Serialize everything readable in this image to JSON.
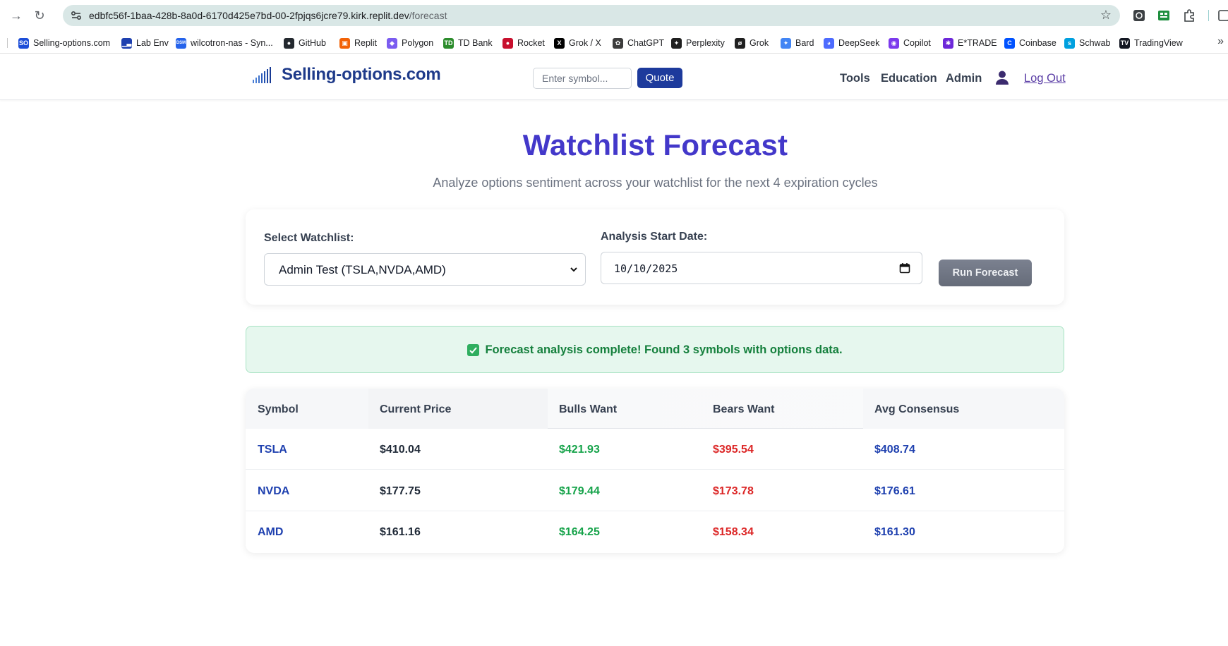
{
  "browser": {
    "url_host": "edbfc56f-1baa-428b-8a0d-6170d425e7bd-00-2fpjqs6jcre79.kirk.replit.dev",
    "url_path": "/forecast",
    "bookmarks": [
      {
        "label": "Selling-options.com",
        "icon": "so-favicon",
        "color": "#1d4ed8",
        "glyph": "SO"
      },
      {
        "label": "Lab Env",
        "icon": "lab-chart-favicon",
        "color": "#1e40af",
        "glyph": "▁▃"
      },
      {
        "label": "wilcotron-nas - Syn...",
        "icon": "dsm-favicon",
        "color": "#2563eb",
        "glyph": "DSM"
      },
      {
        "label": "GitHub",
        "icon": "github-icon",
        "color": "#24292f",
        "glyph": "●"
      },
      {
        "label": "Replit",
        "icon": "replit-icon",
        "color": "#f26207",
        "glyph": "▣"
      },
      {
        "label": "Polygon",
        "icon": "polygon-icon",
        "color": "#7b5cf0",
        "glyph": "◆"
      },
      {
        "label": "TD Bank",
        "icon": "td-bank-icon",
        "color": "#2c8c2c",
        "glyph": "TD"
      },
      {
        "label": "Rocket",
        "icon": "rocket-icon",
        "color": "#c8102e",
        "glyph": "●"
      },
      {
        "label": "Grok / X",
        "icon": "x-icon",
        "color": "#000000",
        "glyph": "X"
      },
      {
        "label": "ChatGPT",
        "icon": "chatgpt-icon",
        "color": "#3c3c3c",
        "glyph": "✿"
      },
      {
        "label": "Perplexity",
        "icon": "perplexity-icon",
        "color": "#1f1f1f",
        "glyph": "✦"
      },
      {
        "label": "Grok",
        "icon": "grok-icon",
        "color": "#1f1f1f",
        "glyph": "ø"
      },
      {
        "label": "Bard",
        "icon": "bard-icon",
        "color": "#4285f4",
        "glyph": "✦"
      },
      {
        "label": "DeepSeek",
        "icon": "deepseek-icon",
        "color": "#4d6bfe",
        "glyph": "◕"
      },
      {
        "label": "Copilot",
        "icon": "copilot-icon",
        "color": "#7c3aed",
        "glyph": "◉"
      },
      {
        "label": "E*TRADE",
        "icon": "etrade-icon",
        "color": "#6d28d9",
        "glyph": "✱"
      },
      {
        "label": "Coinbase",
        "icon": "coinbase-icon",
        "color": "#0052ff",
        "glyph": "C"
      },
      {
        "label": "Schwab",
        "icon": "schwab-icon",
        "color": "#00a0df",
        "glyph": "s"
      },
      {
        "label": "TradingView",
        "icon": "tradingview-icon",
        "color": "#131722",
        "glyph": "TV"
      }
    ]
  },
  "header": {
    "brand": "Selling-options.com",
    "symbol_placeholder": "Enter symbol...",
    "quote_label": "Quote",
    "nav": [
      "Tools",
      "Education",
      "Admin"
    ],
    "logout_label": "Log Out"
  },
  "main": {
    "title": "Watchlist Forecast",
    "subtitle": "Analyze options sentiment across your watchlist for the next 4 expiration cycles",
    "watchlist_label": "Select Watchlist:",
    "watchlist_value": "Admin Test (TSLA,NVDA,AMD)",
    "date_label": "Analysis Start Date:",
    "date_value": "10/10/2025",
    "run_label": "Run Forecast",
    "success_message": "Forecast analysis complete! Found 3 symbols with options data."
  },
  "table": {
    "headers": [
      "Symbol",
      "Current Price",
      "Bulls Want",
      "Bears Want",
      "Avg Consensus"
    ],
    "rows": [
      [
        "TSLA",
        "$410.04",
        "$421.93",
        "$395.54",
        "$408.74"
      ],
      [
        "NVDA",
        "$177.75",
        "$179.44",
        "$173.78",
        "$176.61"
      ],
      [
        "AMD",
        "$161.16",
        "$164.25",
        "$158.34",
        "$161.30"
      ]
    ]
  },
  "colors": {
    "brand": "#1e3a8a",
    "title": "#4338ca",
    "bull": "#16a34a",
    "bear": "#dc2626",
    "success_bg": "#e6f7ee"
  }
}
